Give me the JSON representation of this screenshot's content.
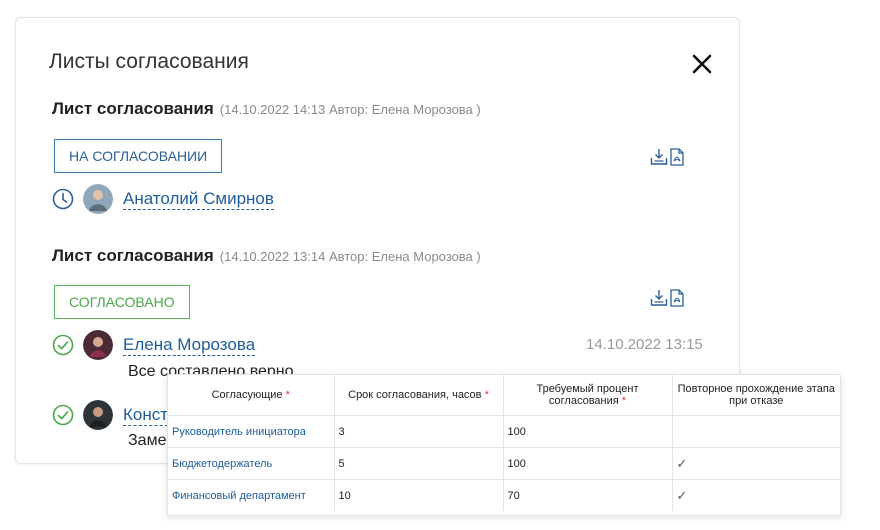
{
  "modal": {
    "title": "Листы согласования"
  },
  "sheets": [
    {
      "heading": "Лист согласования",
      "meta": "(14.10.2022 14:13 Автор: Елена Морозова )",
      "status": "НА СОГЛАСОВАНИИ",
      "approvers": [
        {
          "name": "Анатолий Смирнов",
          "state_icon": "clock-icon"
        }
      ]
    },
    {
      "heading": "Лист согласования",
      "meta": "(14.10.2022 13:14 Автор: Елена Морозова )",
      "status": "СОГЛАСОВАНО",
      "approvers": [
        {
          "name": "Елена Морозова",
          "state_icon": "check-circle-icon",
          "datetime": "14.10.2022 13:15",
          "comment": "Все составлено верно"
        },
        {
          "name": "Конст",
          "state_icon": "check-circle-icon",
          "comment": "Заме"
        }
      ]
    }
  ],
  "colors": {
    "link": "#1f5c99",
    "pending": "#3c7ab5",
    "approved": "#5cb85c",
    "required": "#e53935"
  },
  "table": {
    "headers": [
      {
        "label": "Согласующие",
        "required": "*"
      },
      {
        "label": "Срок согласования, часов",
        "required": "*"
      },
      {
        "label": "Требуемый процент согласования",
        "required": "*"
      },
      {
        "label": "Повторное прохождение этапа при отказе",
        "required": ""
      }
    ],
    "rows": [
      {
        "role": "Руководитель инициатора",
        "hours": "3",
        "percent": "100",
        "repeat": ""
      },
      {
        "role": "Бюджетодержатель",
        "hours": "5",
        "percent": "100",
        "repeat": "✓"
      },
      {
        "role": "Финансовый департамент",
        "hours": "10",
        "percent": "70",
        "repeat": "✓"
      }
    ]
  }
}
